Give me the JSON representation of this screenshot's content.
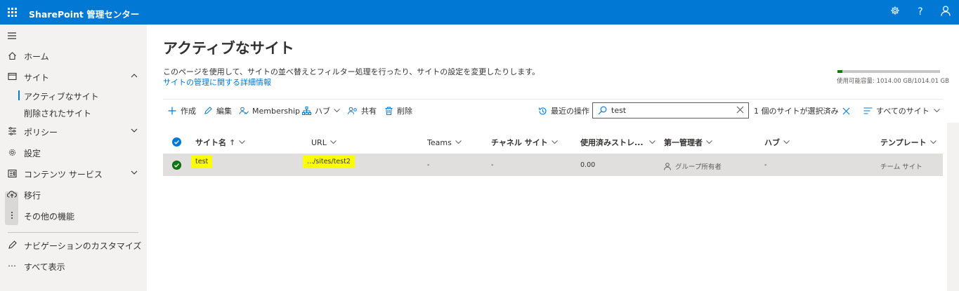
{
  "header": {
    "app_title": "SharePoint 管理センター",
    "icons": [
      "waffle-icon",
      "gear-icon",
      "help-icon",
      "person-icon"
    ],
    "help_label": "?"
  },
  "sidebar": {
    "items": [
      {
        "label": "ホーム",
        "icon": "home-icon"
      },
      {
        "label": "サイト",
        "icon": "site-icon",
        "expanded": true
      },
      {
        "label": "アクティブなサイト",
        "sub": true,
        "active": true
      },
      {
        "label": "削除されたサイト",
        "sub": true
      },
      {
        "label": "ポリシー",
        "icon": "policy-icon"
      },
      {
        "label": "設定",
        "icon": "settings-icon"
      },
      {
        "label": "コンテンツ サービス",
        "icon": "content-icon"
      },
      {
        "label": "移行",
        "icon": "cloud-upload-icon"
      },
      {
        "label": "その他の機能",
        "icon": "more-vertical-icon"
      },
      {
        "label": "ナビゲーションのカスタマイズ",
        "icon": "pencil-icon"
      },
      {
        "label": "すべて表示",
        "icon": "ellipsis-icon"
      }
    ],
    "ellipsis": "⋯"
  },
  "main": {
    "title": "アクティブなサイト",
    "description": "このページを使用して、サイトの並べ替えとフィルター処理を行ったり、サイトの設定を変更したりします。",
    "link": "サイトの管理に関する詳細情報",
    "storage": {
      "text": "使用可能容量: 1014.00 GB/1014.01 GB",
      "used_fraction": 0.05,
      "color": "#107c10"
    }
  },
  "toolbar": {
    "create": "作成",
    "edit": "編集",
    "membership": "Membership",
    "hub": "ハブ",
    "share": "共有",
    "delete": "削除",
    "recent": "最近の操作",
    "search_value": "test",
    "selected_count": "1 個のサイトが選択済み",
    "view": "すべてのサイト"
  },
  "table": {
    "columns": {
      "site_name": "サイト名",
      "sort_arrow": "↑",
      "url": "URL",
      "teams": "Teams",
      "channel": "チャネル サイト",
      "storage": "使用済みストレ...",
      "admin": "第一管理者",
      "hub": "ハブ",
      "template": "テンプレート"
    },
    "rows": [
      {
        "site_name": "test",
        "url": ".../sites/test2",
        "teams": "-",
        "channel": "-",
        "storage": "0.00",
        "admin": "グループ所有者",
        "hub": "-",
        "template": "チーム サイト",
        "selected": true
      }
    ]
  },
  "colors": {
    "accent": "#0078d4",
    "sidebar_bg": "#f3f2f1",
    "selected_row": "#e1dfdd",
    "highlight": "#ffff00",
    "success": "#107c10"
  }
}
